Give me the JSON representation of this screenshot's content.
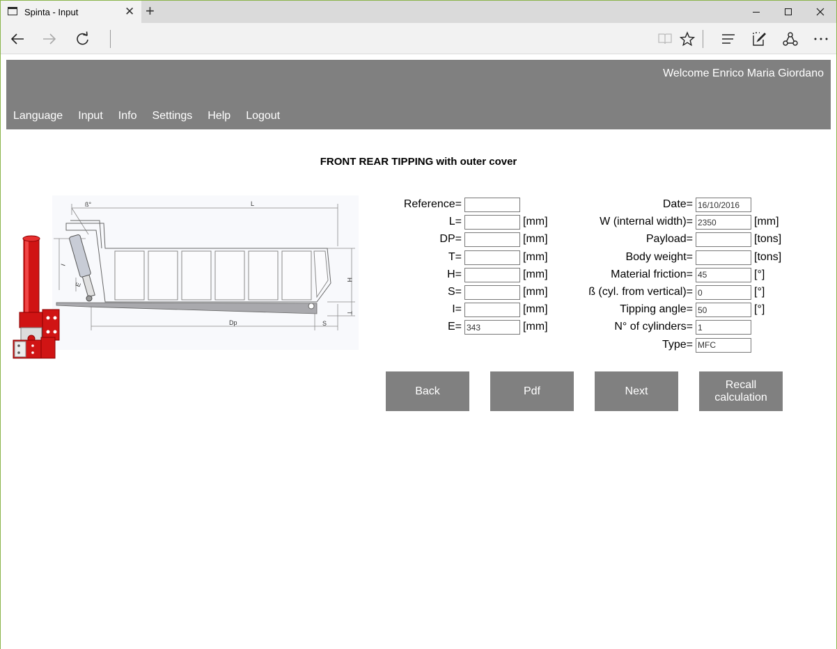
{
  "browser": {
    "tab_title": "Spinta - Input",
    "tab_close": "✕",
    "new_tab": "+"
  },
  "header": {
    "welcome": "Welcome Enrico Maria Giordano",
    "nav": [
      "Language",
      "Input",
      "Info",
      "Settings",
      "Help",
      "Logout"
    ]
  },
  "main": {
    "title": "FRONT REAR TIPPING with outer cover"
  },
  "drawing": {
    "labels": {
      "beta": "ß°",
      "L": "L",
      "H": "H",
      "I": "I",
      "E": "E",
      "T": "T",
      "Dp": "Dp",
      "S": "S"
    }
  },
  "form_left": [
    {
      "label": "Reference=",
      "value": "",
      "unit": ""
    },
    {
      "label": "L=",
      "value": "",
      "unit": "[mm]"
    },
    {
      "label": "DP=",
      "value": "",
      "unit": "[mm]"
    },
    {
      "label": "T=",
      "value": "",
      "unit": "[mm]"
    },
    {
      "label": "H=",
      "value": "",
      "unit": "[mm]"
    },
    {
      "label": "S=",
      "value": "",
      "unit": "[mm]"
    },
    {
      "label": "I=",
      "value": "",
      "unit": "[mm]"
    },
    {
      "label": "E=",
      "value": "343",
      "unit": "[mm]"
    }
  ],
  "form_right": [
    {
      "label": "Date=",
      "value": "16/10/2016",
      "unit": ""
    },
    {
      "label": "W (internal width)=",
      "value": "2350",
      "unit": "[mm]"
    },
    {
      "label": "Payload=",
      "value": "",
      "unit": "[tons]"
    },
    {
      "label": "Body weight=",
      "value": "",
      "unit": "[tons]"
    },
    {
      "label": "Material friction=",
      "value": "45",
      "unit": "[°]"
    },
    {
      "label": "ß (cyl. from vertical)=",
      "value": "0",
      "unit": "[°]"
    },
    {
      "label": "Tipping angle=",
      "value": "50",
      "unit": "[°]"
    },
    {
      "label": "N° of cylinders=",
      "value": "1",
      "unit": ""
    },
    {
      "label": "Type=",
      "value": "MFC",
      "unit": ""
    }
  ],
  "buttons": {
    "back": "Back",
    "pdf": "Pdf",
    "next": "Next",
    "recall_line1": "Recall",
    "recall_line2": "calculation"
  },
  "colors": {
    "banner": "#808080",
    "cylinder_red": "#d01414",
    "window_border": "#8ab44a"
  }
}
